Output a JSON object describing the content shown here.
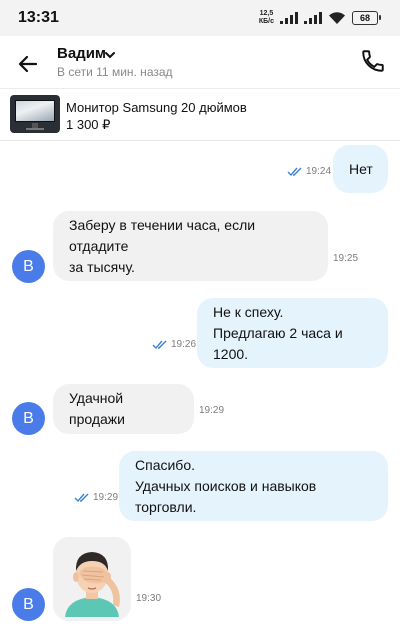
{
  "status_bar": {
    "time": "13:31",
    "net_speed_value": "12,5",
    "net_speed_unit": "КБ/с",
    "battery": "68"
  },
  "header": {
    "contact_name": "Вадим",
    "last_seen": "В сети 11 мин. назад"
  },
  "listing": {
    "title": "Монитор Samsung 20 дюймов",
    "price": "1 300 ₽"
  },
  "messages": [
    {
      "direction": "out",
      "lines": [
        "Нет"
      ],
      "time": "19:24",
      "read": true
    },
    {
      "direction": "in",
      "lines": [
        "Заберу в течении часа, если отдадите",
        "за тысячу."
      ],
      "time": "19:25",
      "avatar": "В"
    },
    {
      "direction": "out",
      "lines": [
        "Не к спеху.",
        "Предлагаю 2 часа и 1200."
      ],
      "time": "19:26",
      "read": true
    },
    {
      "direction": "in",
      "lines": [
        "Удачной продажи"
      ],
      "time": "19:29",
      "avatar": "В"
    },
    {
      "direction": "out",
      "lines": [
        "Спасибо.",
        "Удачных поисков и навыков торговли."
      ],
      "time": "19:29",
      "read": true
    },
    {
      "direction": "in",
      "sticker": "facepalm-emoji",
      "time": "19:30",
      "avatar": "В"
    }
  ],
  "colors": {
    "outgoing_bubble": "#e5f3fd",
    "incoming_bubble": "#f1f1f1",
    "avatar": "#4a7ce9",
    "read_check": "#3b82d6"
  }
}
